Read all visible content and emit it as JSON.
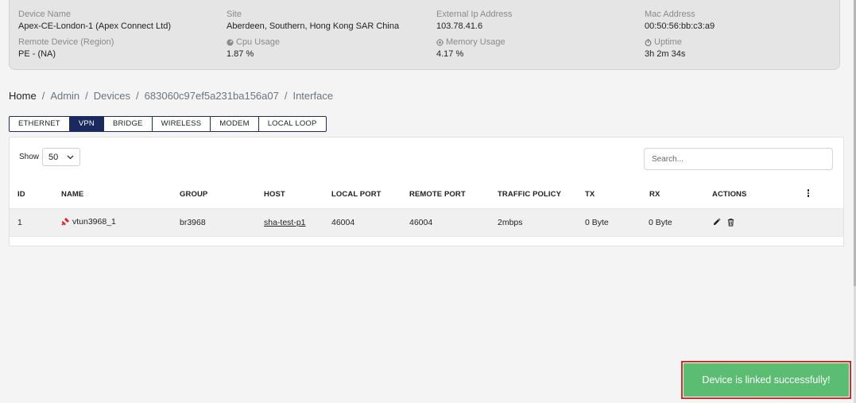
{
  "device": {
    "name_label": "Device Name",
    "name_value": "Apex-CE-London-1 (Apex Connect Ltd)",
    "site_label": "Site",
    "site_value": "Aberdeen, Southern, Hong Kong SAR China",
    "ip_label": "External Ip Address",
    "ip_value": "103.78.41.6",
    "mac_label": "Mac Address",
    "mac_value": "00:50:56:bb:c3:a9",
    "remote_label": "Remote Device (Region)",
    "remote_value": "PE - (NA)",
    "cpu_label": "Cpu Usage",
    "cpu_value": "1.87 %",
    "memory_label": "Memory Usage",
    "memory_value": "4.17 %",
    "uptime_label": "Uptime",
    "uptime_value": "3h 2m 34s"
  },
  "breadcrumb": {
    "home": "Home",
    "sep": "/",
    "items": [
      "Admin",
      "Devices",
      "683060c97ef5a231ba156a07",
      "Interface"
    ]
  },
  "tabs": [
    "ETHERNET",
    "VPN",
    "BRIDGE",
    "WIRELESS",
    "MODEM",
    "LOCAL LOOP"
  ],
  "active_tab": "VPN",
  "table": {
    "show_label": "Show",
    "page_size": "50",
    "search_placeholder": "Search...",
    "columns": [
      "ID",
      "NAME",
      "GROUP",
      "HOST",
      "LOCAL PORT",
      "REMOTE PORT",
      "TRAFFIC POLICY",
      "TX",
      "RX",
      "ACTIONS"
    ],
    "rows": [
      {
        "id": "1",
        "name": "vtun3968_1",
        "group": "br3968",
        "host": "sha-test-p1",
        "local_port": "46004",
        "remote_port": "46004",
        "traffic_policy": "2mbps",
        "tx": "0 Byte",
        "rx": "0 Byte"
      }
    ]
  },
  "toast": {
    "message": "Device is linked successfully!"
  },
  "colors": {
    "tab_active": "#1b2a5e",
    "toast_bg": "#5bbd72",
    "toast_border": "#d42a2a",
    "status_icon": "#e02020"
  }
}
